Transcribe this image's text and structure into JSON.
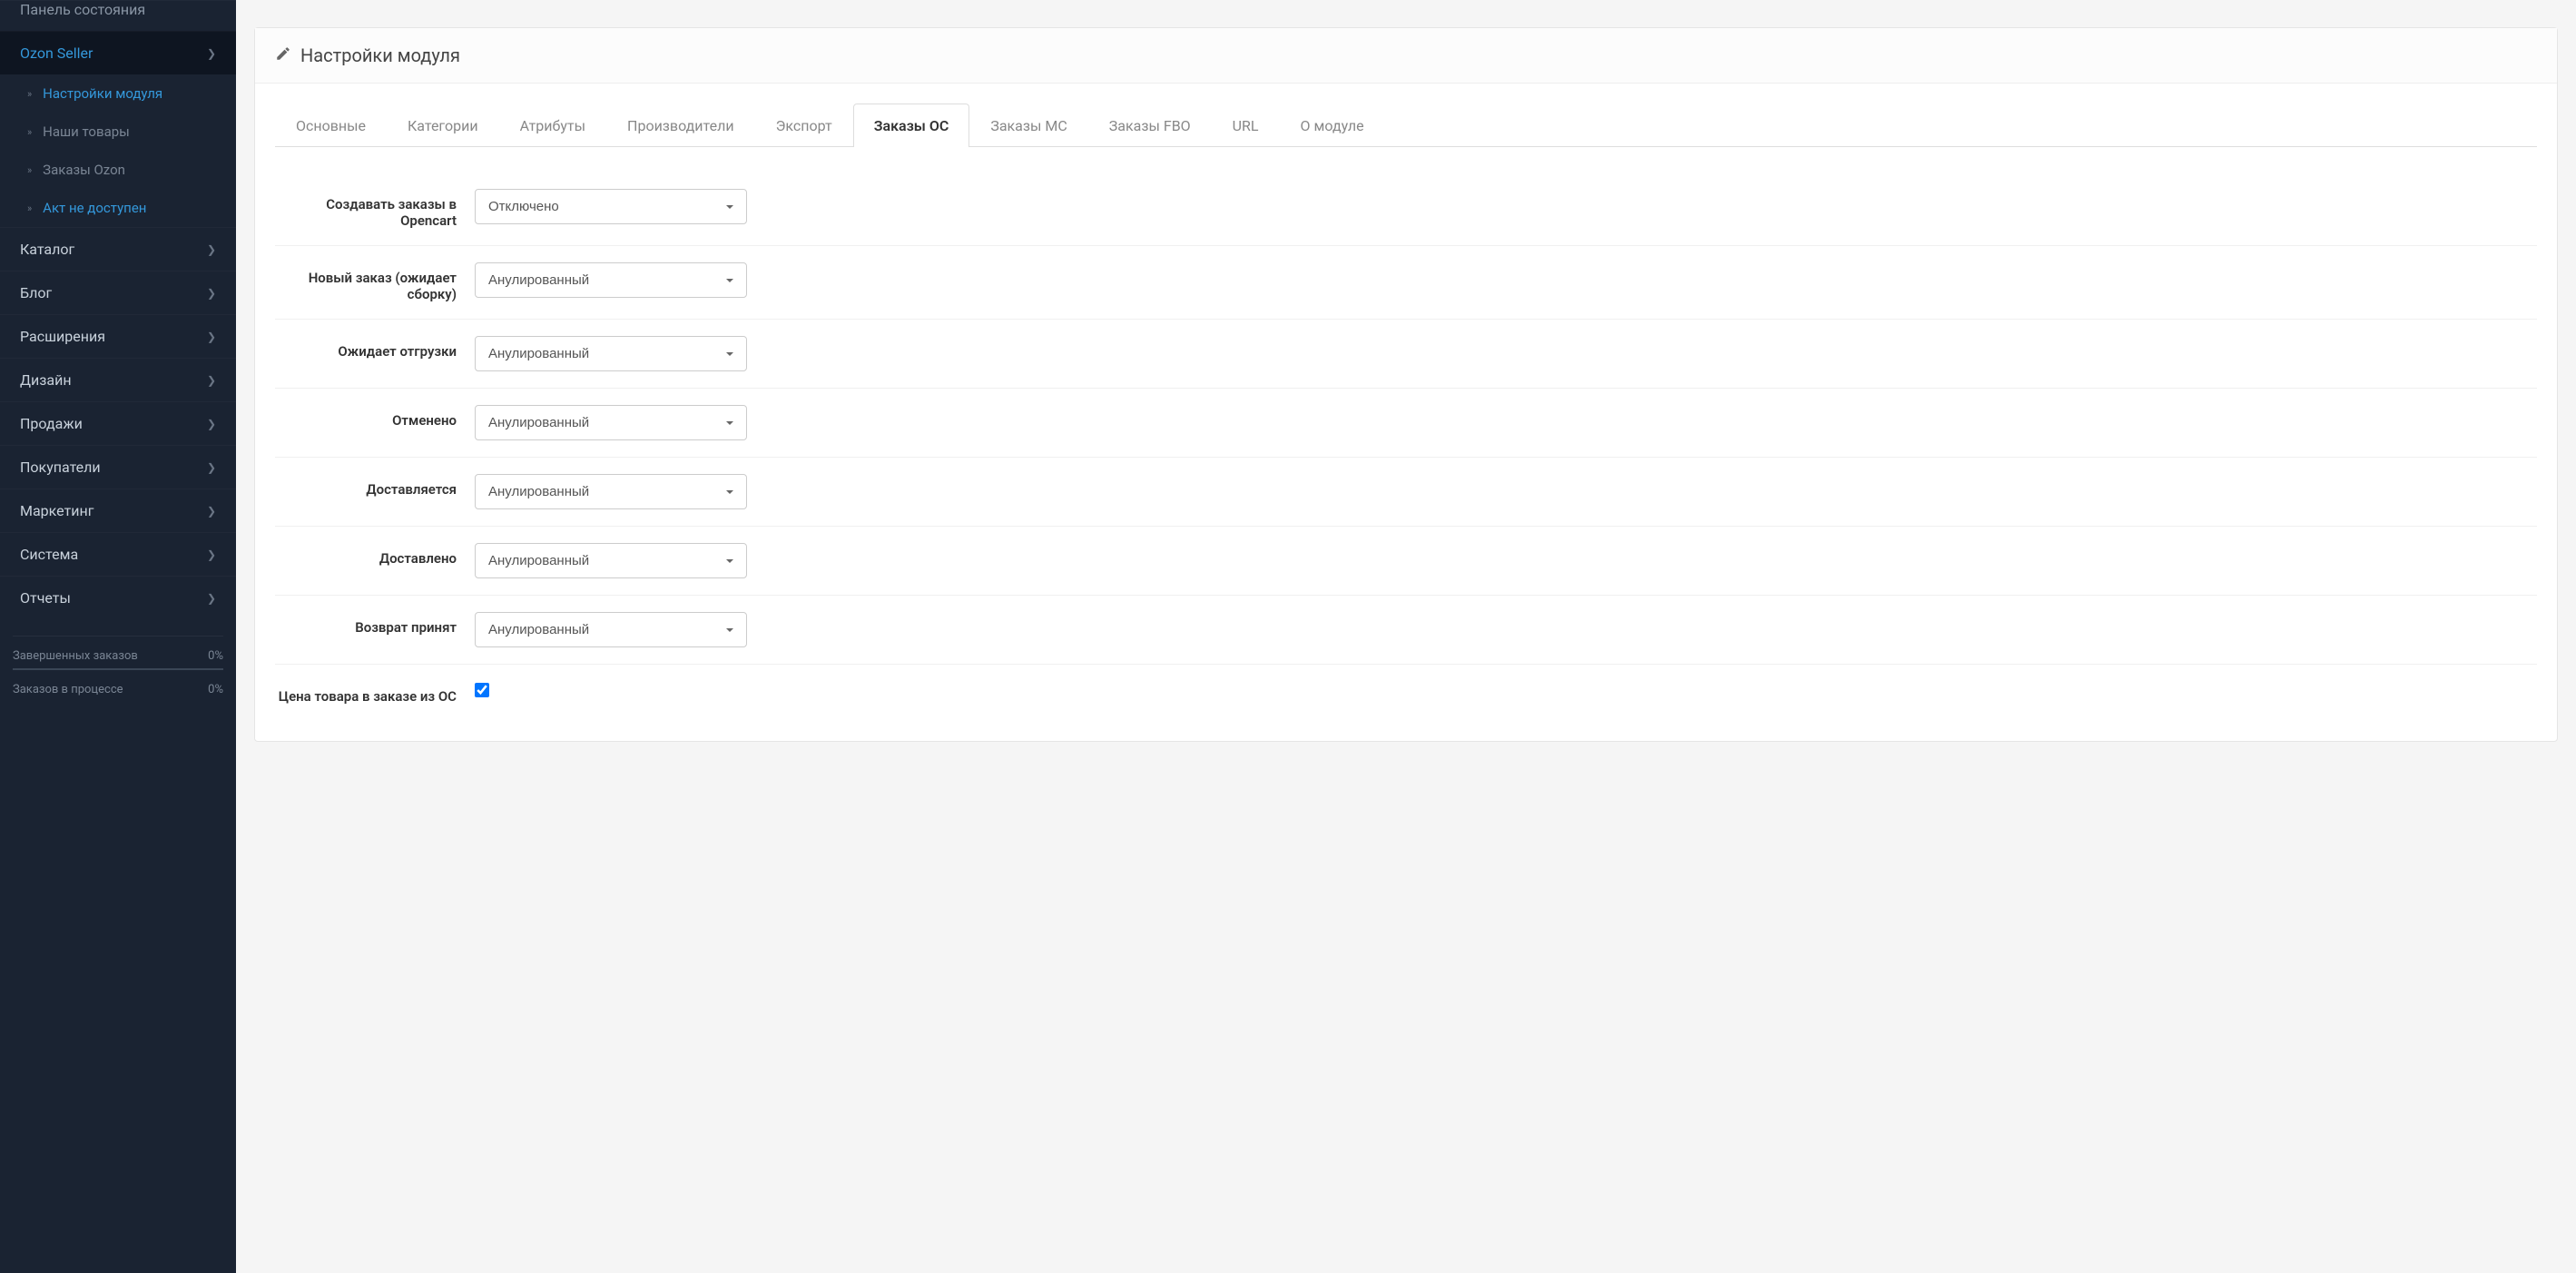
{
  "sidebar": {
    "top_cut": "Панель состояния",
    "ozon_seller": "Ozon Seller",
    "sub": [
      {
        "label": "Настройки модуля",
        "active": true
      },
      {
        "label": "Наши товары",
        "active": false
      },
      {
        "label": "Заказы Ozon",
        "active": false
      },
      {
        "label": "Акт не доступен",
        "active": true
      }
    ],
    "items": [
      "Каталог",
      "Блог",
      "Расширения",
      "Дизайн",
      "Продажи",
      "Покупатели",
      "Маркетинг",
      "Система",
      "Отчеты"
    ],
    "stats": [
      {
        "label": "Завершенных заказов",
        "value": "0%"
      },
      {
        "label": "Заказов в процессе",
        "value": "0%"
      }
    ]
  },
  "panel": {
    "title": "Настройки модуля"
  },
  "tabs": [
    {
      "label": "Основные",
      "active": false
    },
    {
      "label": "Категории",
      "active": false
    },
    {
      "label": "Атрибуты",
      "active": false
    },
    {
      "label": "Производители",
      "active": false
    },
    {
      "label": "Экспорт",
      "active": false
    },
    {
      "label": "Заказы ОС",
      "active": true
    },
    {
      "label": "Заказы МС",
      "active": false
    },
    {
      "label": "Заказы FBO",
      "active": false
    },
    {
      "label": "URL",
      "active": false
    },
    {
      "label": "О модуле",
      "active": false
    }
  ],
  "form": {
    "create_orders": {
      "label": "Создавать заказы в Opencart",
      "value": "Отключено"
    },
    "new_order": {
      "label": "Новый заказ (ожидает сборку)",
      "value": "Анулированный"
    },
    "awaiting_ship": {
      "label": "Ожидает отгрузки",
      "value": "Анулированный"
    },
    "cancelled": {
      "label": "Отменено",
      "value": "Анулированный"
    },
    "delivering": {
      "label": "Доставляется",
      "value": "Анулированный"
    },
    "delivered": {
      "label": "Доставлено",
      "value": "Анулированный"
    },
    "return_accepted": {
      "label": "Возврат принят",
      "value": "Анулированный"
    },
    "price_from_oc": {
      "label": "Цена товара в заказе из ОС",
      "checked": true
    }
  }
}
